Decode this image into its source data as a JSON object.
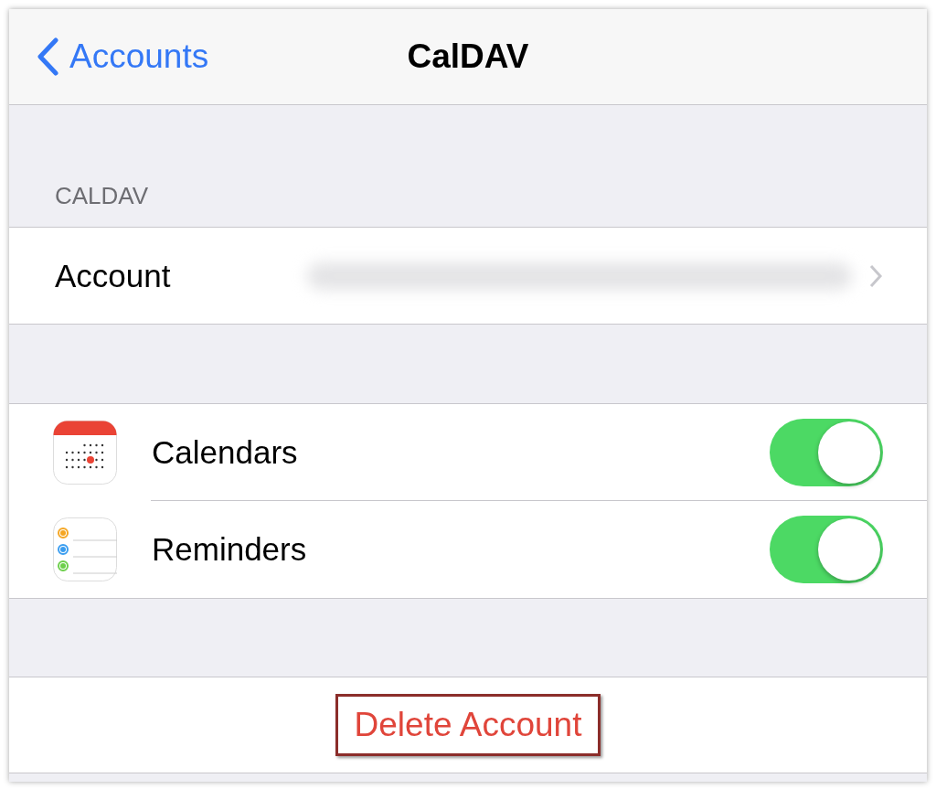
{
  "nav": {
    "back_label": "Accounts",
    "title": "CalDAV"
  },
  "section_header": "CALDAV",
  "account_row": {
    "label": "Account",
    "value_blurred": true
  },
  "toggles": [
    {
      "kind": "calendar",
      "label": "Calendars",
      "on": true
    },
    {
      "kind": "reminders",
      "label": "Reminders",
      "on": true
    }
  ],
  "delete_button": {
    "label": "Delete Account",
    "highlighted": true
  }
}
